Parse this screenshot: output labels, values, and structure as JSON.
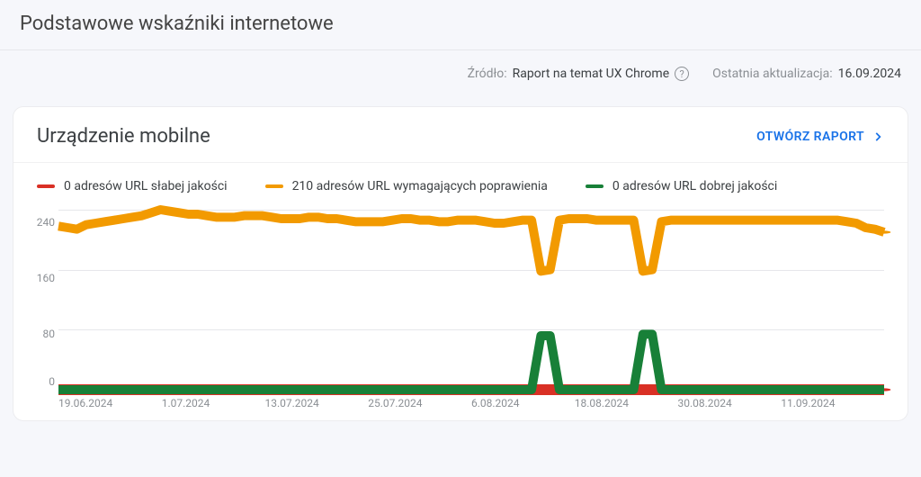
{
  "page": {
    "title": "Podstawowe wskaźniki internetowe"
  },
  "meta": {
    "source_label": "Źródło:",
    "source_link_text": "Raport na temat UX Chrome",
    "updated_label": "Ostatnia aktualizacja:",
    "updated_value": "16.09.2024"
  },
  "card": {
    "title": "Urządzenie mobilne",
    "open_report_label": "OTWÓRZ RAPORT"
  },
  "legend": {
    "poor": "0 adresów URL słabej jakości",
    "needs": "210 adresów URL wymagających poprawienia",
    "good": "0 adresów URL dobrej jakości"
  },
  "colors": {
    "poor": "#d93025",
    "needs": "#f29a00",
    "good": "#188038",
    "accent": "#1a73e8"
  },
  "chart_data": {
    "type": "line",
    "ylim": [
      0,
      240
    ],
    "y_ticks": [
      240,
      160,
      80,
      0
    ],
    "x_ticks": [
      "19.06.2024",
      "1.07.2024",
      "13.07.2024",
      "25.07.2024",
      "6.08.2024",
      "18.08.2024",
      "30.08.2024",
      "11.09.2024"
    ],
    "series": [
      {
        "name": "poor",
        "color": "#d93025",
        "values": [
          0,
          0,
          0,
          0,
          0,
          0,
          0,
          0,
          0,
          0,
          0,
          0,
          0,
          0,
          0,
          0,
          0,
          0,
          0,
          0,
          0,
          0,
          0,
          0,
          0,
          0,
          0,
          0,
          0,
          0,
          0,
          0,
          0,
          0,
          0,
          0,
          0,
          0,
          0,
          0,
          0,
          0,
          0,
          0,
          0,
          0,
          0,
          0,
          0,
          0,
          0,
          0,
          0,
          0,
          0,
          0,
          0,
          0,
          0,
          0,
          0,
          0,
          0,
          0,
          0,
          0,
          0,
          0,
          0,
          0,
          0,
          0,
          0,
          0,
          0,
          0,
          0,
          0,
          0,
          0,
          0,
          0,
          0,
          0,
          0,
          0,
          0,
          0,
          0,
          0
        ]
      },
      {
        "name": "needs",
        "color": "#f29a00",
        "values": [
          218,
          216,
          214,
          220,
          222,
          224,
          226,
          228,
          230,
          232,
          236,
          240,
          238,
          236,
          234,
          234,
          232,
          230,
          230,
          230,
          232,
          232,
          232,
          230,
          228,
          228,
          228,
          230,
          230,
          228,
          228,
          226,
          224,
          224,
          224,
          224,
          226,
          228,
          228,
          226,
          226,
          224,
          224,
          226,
          226,
          226,
          224,
          222,
          222,
          224,
          226,
          226,
          158,
          160,
          226,
          228,
          228,
          228,
          226,
          226,
          226,
          226,
          226,
          158,
          160,
          224,
          226,
          226,
          226,
          226,
          226,
          226,
          226,
          226,
          226,
          226,
          226,
          226,
          226,
          226,
          226,
          226,
          226,
          226,
          226,
          224,
          222,
          216,
          214,
          210
        ]
      },
      {
        "name": "good",
        "color": "#188038",
        "values": [
          0,
          0,
          0,
          0,
          0,
          0,
          0,
          0,
          0,
          0,
          0,
          0,
          0,
          0,
          0,
          0,
          0,
          0,
          0,
          0,
          0,
          0,
          0,
          0,
          0,
          0,
          0,
          0,
          0,
          0,
          0,
          0,
          0,
          0,
          0,
          0,
          0,
          0,
          0,
          0,
          0,
          0,
          0,
          0,
          0,
          0,
          0,
          0,
          0,
          0,
          0,
          0,
          72,
          72,
          0,
          0,
          0,
          0,
          0,
          0,
          0,
          0,
          0,
          74,
          74,
          0,
          0,
          0,
          0,
          0,
          0,
          0,
          0,
          0,
          0,
          0,
          0,
          0,
          0,
          0,
          0,
          0,
          0,
          0,
          0,
          0,
          0,
          0,
          0,
          0
        ]
      }
    ]
  }
}
